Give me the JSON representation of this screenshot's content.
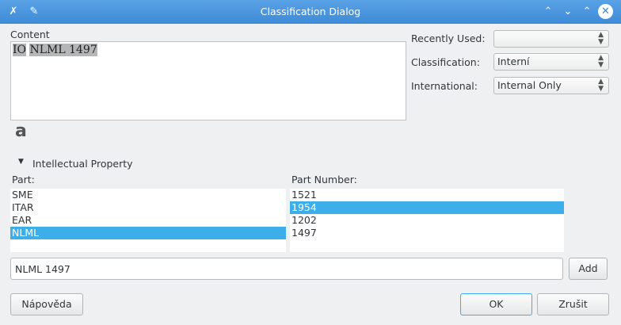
{
  "titlebar": {
    "title": "Classification Dialog",
    "app_icon": "x-app-icon",
    "pin_icon": "pin-icon"
  },
  "content": {
    "label": "Content",
    "text_part1": "IO",
    "text_part2": "NLML 1497"
  },
  "recently_used": {
    "label": "Recently Used:",
    "value": ""
  },
  "classification": {
    "label": "Classification:",
    "value": "Interní"
  },
  "international": {
    "label": "International:",
    "value": "Internal Only"
  },
  "font_glyph": "a",
  "ip_section": {
    "label": "Intellectual Property"
  },
  "part": {
    "label": "Part:",
    "items": [
      "SME",
      "ITAR",
      "EAR",
      "NLML"
    ],
    "selected": 3
  },
  "part_number": {
    "label": "Part Number:",
    "items": [
      "1521",
      "1954",
      "1202",
      "1497"
    ],
    "selected": 1
  },
  "entry": {
    "value": "NLML 1497"
  },
  "buttons": {
    "add": "Add",
    "help": "Nápověda",
    "ok": "OK",
    "cancel": "Zrušit"
  }
}
